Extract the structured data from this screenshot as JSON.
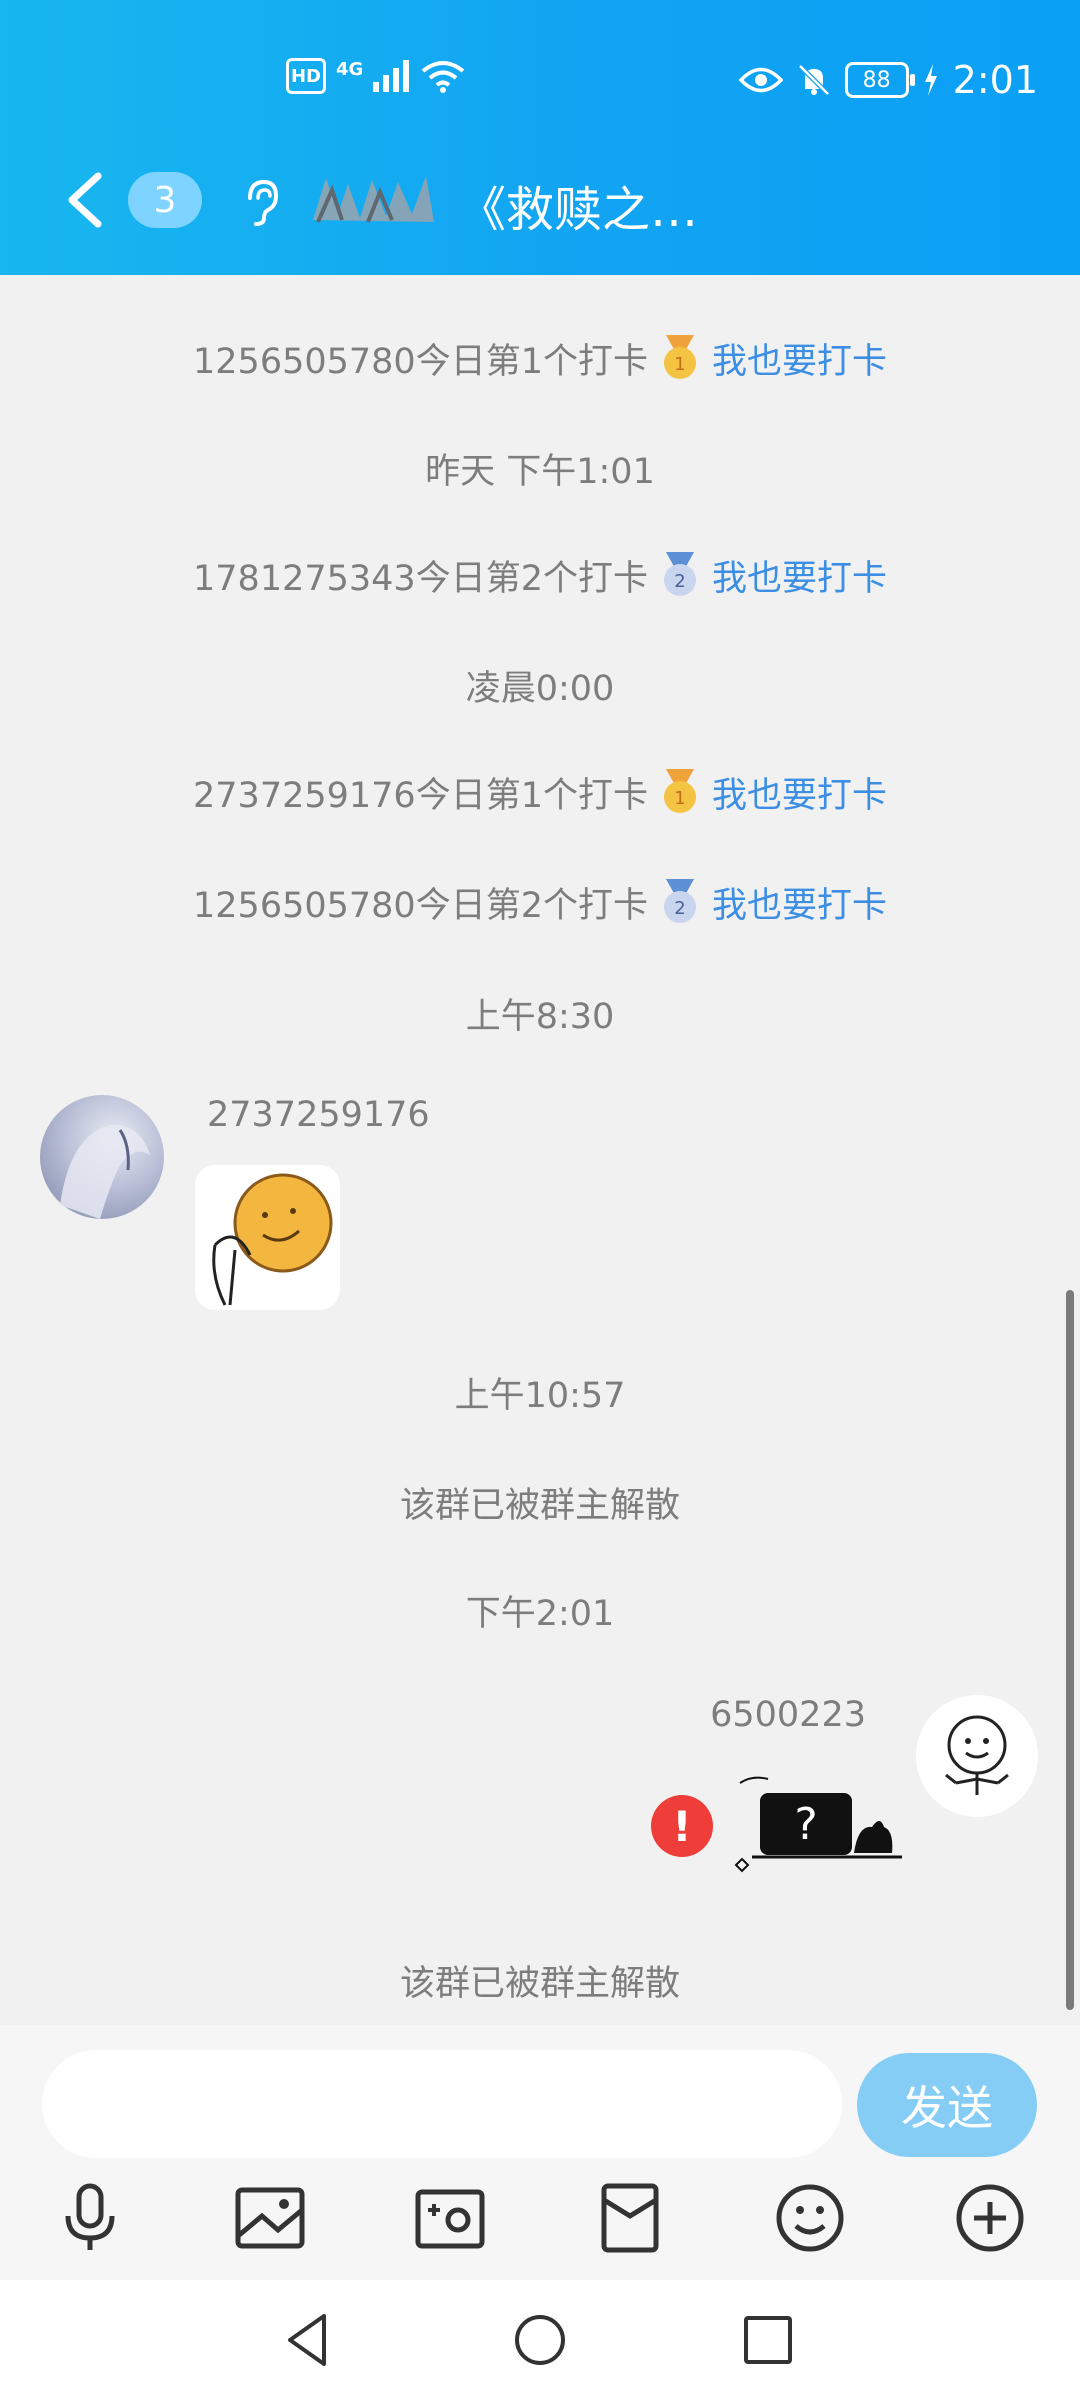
{
  "status_bar": {
    "hd": "HD",
    "network": "4G",
    "battery": "88",
    "time": "2:01"
  },
  "header": {
    "unread_count": "3",
    "group_title": "《救赎之…"
  },
  "chat": {
    "messages": [
      {
        "type": "checkin",
        "text": "1256505780今日第1个打卡",
        "medal": "1",
        "link": "我也要打卡"
      },
      {
        "type": "time",
        "text": "昨天 下午1:01"
      },
      {
        "type": "checkin",
        "text": "1781275343今日第2个打卡",
        "medal": "2",
        "link": "我也要打卡"
      },
      {
        "type": "time",
        "text": "凌晨0:00"
      },
      {
        "type": "checkin",
        "text": "2737259176今日第1个打卡",
        "medal": "1",
        "link": "我也要打卡"
      },
      {
        "type": "checkin",
        "text": "1256505780今日第2个打卡",
        "medal": "2",
        "link": "我也要打卡"
      },
      {
        "type": "time",
        "text": "上午8:30"
      },
      {
        "type": "message",
        "sender": "2737259176",
        "side": "left",
        "content": "sticker"
      },
      {
        "type": "time",
        "text": "上午10:57"
      },
      {
        "type": "system",
        "text": "该群已被群主解散"
      },
      {
        "type": "time",
        "text": "下午2:01"
      },
      {
        "type": "message",
        "sender": "6500223",
        "side": "right",
        "content": "sticker",
        "failed": true
      },
      {
        "type": "system",
        "text": "该群已被群主解散"
      }
    ]
  },
  "input": {
    "placeholder": "",
    "send_label": "发送"
  },
  "toolbar": {
    "icons": [
      "microphone-icon",
      "image-icon",
      "camera-icon",
      "red-packet-icon",
      "emoji-icon",
      "plus-icon"
    ]
  },
  "colors": {
    "header_gradient_start": "#18b7f0",
    "header_gradient_end": "#0aa0f5",
    "link": "#3b8ee3",
    "send_button": "#86cdf5",
    "error": "#ef3d3a"
  }
}
